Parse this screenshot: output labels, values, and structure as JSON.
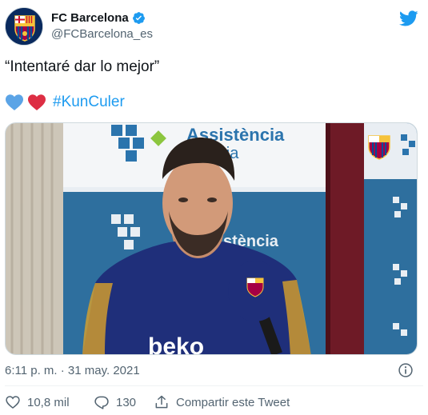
{
  "tweet": {
    "display_name": "FC Barcelona",
    "handle": "@FCBarcelona_es",
    "text": "“Intentaré dar lo mejor”",
    "hashtag": "#KunCuler",
    "timestamp": "6:11 p. m. · 31 may. 2021",
    "likes": "10,8 mil",
    "replies": "130",
    "share_label": "Compartir este Tweet"
  },
  "media": {
    "backdrop_text_1": "Assistència",
    "backdrop_text_2": "ària",
    "backdrop_text_3": "stència",
    "shirt_text": "beko"
  },
  "icons": {
    "avatar": "fc-barcelona-crest",
    "verified": "verified-badge-icon",
    "brand": "twitter-bird-icon",
    "info": "info-icon",
    "like": "heart-outline-icon",
    "reply": "reply-bubble-icon",
    "share": "share-upload-icon"
  },
  "colors": {
    "accent": "#1d9bf0",
    "heart_blue": "#5ba4e6",
    "heart_red": "#e0245e",
    "text_secondary": "#536471"
  }
}
